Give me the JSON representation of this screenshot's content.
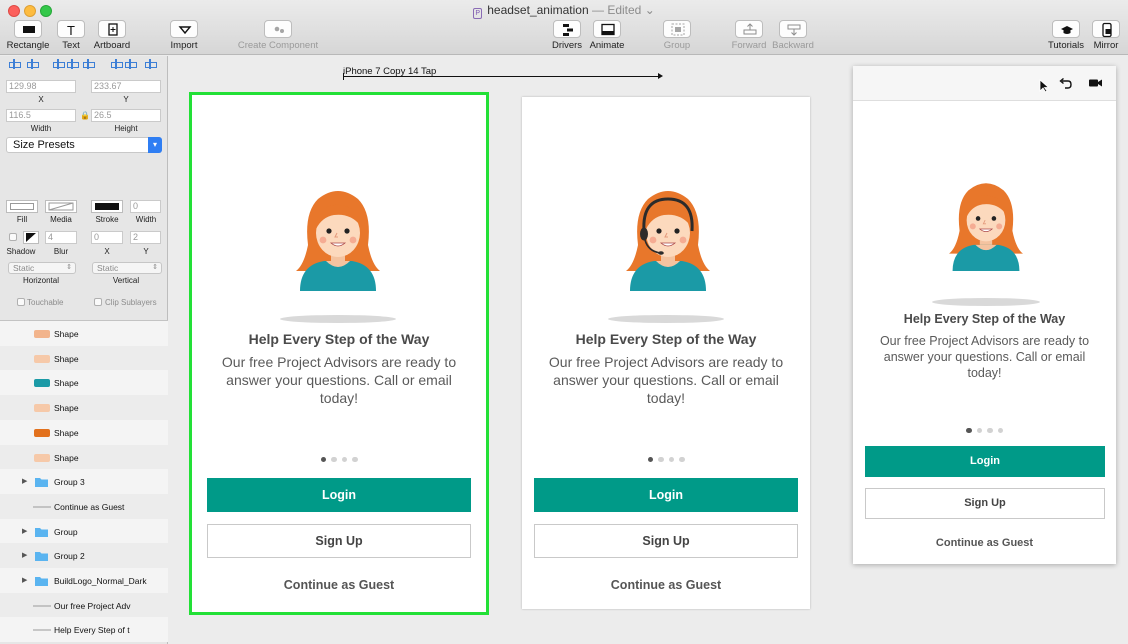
{
  "window": {
    "title": "headset_animation",
    "edited": "— Edited"
  },
  "toolbar": {
    "rectangle": "Rectangle",
    "text": "Text",
    "artboard": "Artboard",
    "import": "Import",
    "create_component": "Create Component",
    "drivers": "Drivers",
    "animate": "Animate",
    "group": "Group",
    "forward": "Forward",
    "backward": "Backward",
    "tutorials": "Tutorials",
    "mirror": "Mirror"
  },
  "inspector": {
    "x_value": "129.98",
    "y_value": "233.67",
    "x_label": "X",
    "y_label": "Y",
    "width_value": "116.5",
    "height_value": "26.5",
    "width_label": "Width",
    "height_label": "Height",
    "size_presets": "Size Presets",
    "fill_label": "Fill",
    "media_label": "Media",
    "stroke_label": "Stroke",
    "stroke_width_value": "0",
    "stroke_width_label": "Width",
    "shadow_label": "Shadow",
    "blur_value": "4",
    "blur_label": "Blur",
    "shadow_x_value": "0",
    "shadow_y_value": "2",
    "shadow_x_label": "X",
    "shadow_y_label": "Y",
    "horizontal_value": "Static",
    "vertical_value": "Static",
    "horizontal_label": "Horizontal",
    "vertical_label": "Vertical",
    "touchable_label": "Touchable",
    "clip_label": "Clip Sublayers"
  },
  "layers": [
    {
      "name": "Shape",
      "thumb": "#f2b48c",
      "folder": false
    },
    {
      "name": "Shape",
      "thumb": "#f6c9a9",
      "folder": false
    },
    {
      "name": "Shape",
      "thumb": "#1b9aa6",
      "folder": false
    },
    {
      "name": "Shape",
      "thumb": "#f6c9a9",
      "folder": false
    },
    {
      "name": "Shape",
      "thumb": "#e2711d",
      "folder": false
    },
    {
      "name": "Shape",
      "thumb": "#f6c9a9",
      "folder": false
    },
    {
      "name": "Group 3",
      "thumb": "#5ab4f0",
      "folder": true
    },
    {
      "name": "Continue as Guest",
      "thumb": "#9a9a9a",
      "folder": false
    },
    {
      "name": "Group",
      "thumb": "#5ab4f0",
      "folder": true
    },
    {
      "name": "Group 2",
      "thumb": "#5ab4f0",
      "folder": true
    },
    {
      "name": "BuildLogo_Normal_Dark",
      "thumb": "#5ab4f0",
      "folder": true
    },
    {
      "name": "Our free Project Adv",
      "thumb": "#9a9a9a",
      "folder": false
    },
    {
      "name": "Help Every Step of t",
      "thumb": "#9a9a9a",
      "folder": false
    }
  ],
  "canvas": {
    "transition_label": "iPhone 7 Copy 14 Tap"
  },
  "screen": {
    "heading": "Help Every Step of the Way",
    "body": "Our free Project Advisors are ready to answer your questions. Call or email today!",
    "login": "Login",
    "signup": "Sign Up",
    "guest": "Continue as Guest",
    "page_count": 4,
    "active_page": 1
  },
  "colors": {
    "primary": "#009a88",
    "selection": "#22e036",
    "hair": "#e8772b",
    "shirt": "#1b9aa6",
    "skin": "#fcd9bd"
  },
  "icons": {
    "cursor": "cursor-icon",
    "undo": "undo-icon",
    "record": "video-camera-icon"
  }
}
